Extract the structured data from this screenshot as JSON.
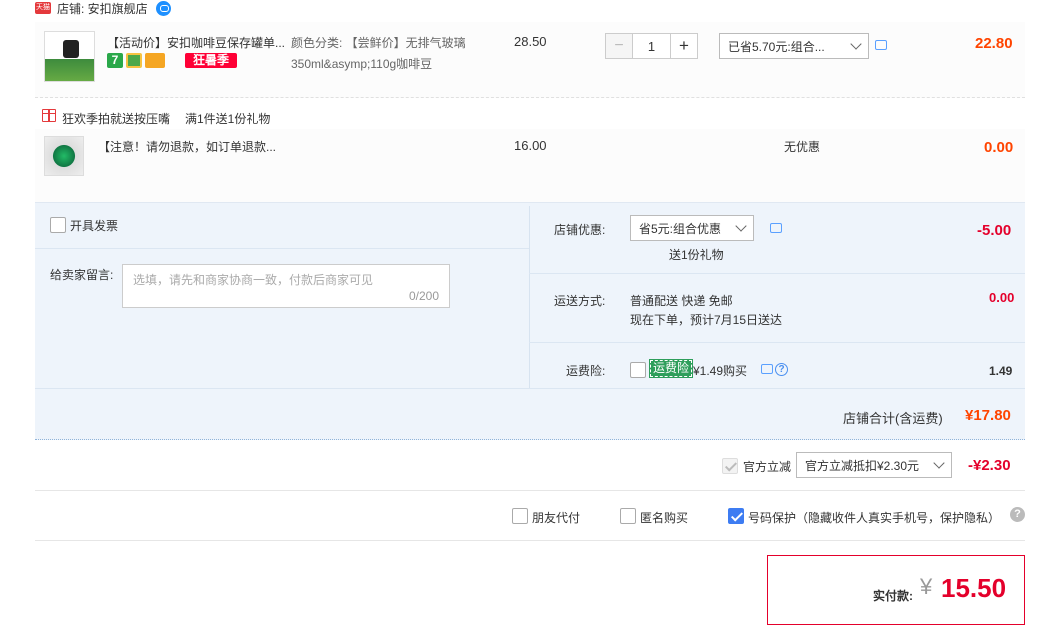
{
  "store": {
    "badge": "天猫",
    "label": "店铺: 安扣旗舰店"
  },
  "items": [
    {
      "title": "【活动价】安扣咖啡豆保存罐单...",
      "sku_line1": "颜色分类: 【尝鲜价】无排气玻璃",
      "sku_line2": "350ml&asymp;110g咖啡豆",
      "unit_price": "28.50",
      "quantity": "1",
      "minus": "−",
      "plus": "+",
      "badge_7": "7",
      "promo_tag": "狂暑季",
      "discount_select": "已省5.70元:组合...",
      "subtotal": "22.80"
    },
    {
      "title": "【注意！请勿退款，如订单退款...",
      "unit_price": "16.00",
      "discount": "无优惠",
      "subtotal": "0.00"
    }
  ],
  "gift": {
    "label": "狂欢季拍就送按压嘴",
    "rule": "满1件送1份礼物"
  },
  "invoice": {
    "label": "开具发票"
  },
  "message": {
    "label": "给卖家留言:",
    "placeholder": "选填，请先和商家协商一致，付款后商家可见",
    "counter": "0/200"
  },
  "store_discount": {
    "label": "店铺优惠:",
    "select": "省5元:组合优惠",
    "note": "送1份礼物",
    "amount": "-5.00"
  },
  "shipping": {
    "label": "运送方式:",
    "method": "普通配送 快递 免邮",
    "eta": "现在下单，预计7月15日送达",
    "amount": "0.00"
  },
  "insurance": {
    "label": "运费险:",
    "tag": "运费险",
    "text": "¥1.49购买",
    "amount": "1.49",
    "help": "?"
  },
  "store_total": {
    "label": "店铺合计(含运费)",
    "amount": "¥17.80"
  },
  "official": {
    "label": "官方立减",
    "select": "官方立减抵扣¥2.30元",
    "amount": "-¥2.30"
  },
  "options": {
    "friend_pay": "朋友代付",
    "anonymous": "匿名购买",
    "privacy": "号码保护（隐藏收件人真实手机号，保护隐私）",
    "help": "?"
  },
  "payment": {
    "label": "实付款:",
    "currency": "¥",
    "amount": "15.50"
  },
  "colors": {
    "accent_red": "#ff4400",
    "panel_bg": "#eef4fb",
    "checkbox_blue": "#3d7cf2"
  }
}
